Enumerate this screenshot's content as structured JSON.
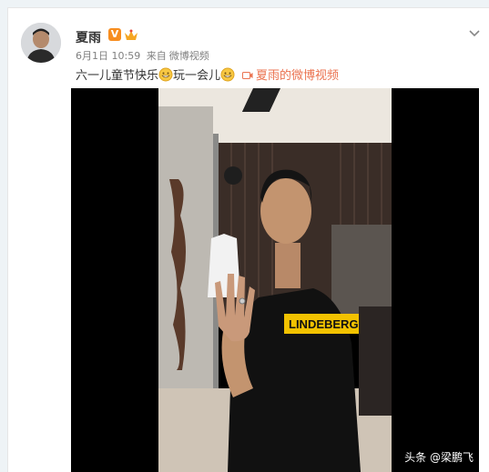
{
  "post": {
    "author": "夏雨",
    "verified_badge": "V",
    "time": "6月1日 10:59",
    "from_label": "来自",
    "source": "微博视频",
    "text": "六一儿童节快乐",
    "text2": "玩一会儿",
    "link_text": "夏雨的微博视频"
  },
  "video": {
    "shirt_text": "LINDEBERG",
    "watermark": "头条 @梁鹏飞"
  },
  "icons": [
    "avatar",
    "verified-v-icon",
    "vip-crown-icon",
    "chevron-down-icon",
    "grin-emoji-icon",
    "video-link-icon"
  ],
  "colors": {
    "link": "#eb7350",
    "badge": "#f78d1f",
    "background": "#eef3f6"
  }
}
